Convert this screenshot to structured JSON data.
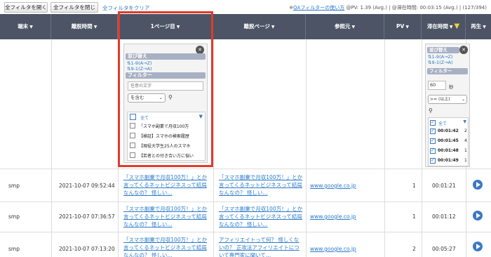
{
  "toolbar": {
    "open_all": "全フィルタを開く",
    "close_all": "全フィルタを閉じる",
    "clear_all": "全フィルタをクリア",
    "info_prefix": "※",
    "qa_link": "QAフィルターの使い方",
    "stats": "@PV: 1.39 (Avg.) | @滞在時間: 00:03:15 (Avg.) | (127/394)"
  },
  "columns": {
    "device": "端末",
    "leave_time": "離脱時間",
    "first_page": "1ページ目",
    "exit_page": "離脱ページ",
    "referrer": "参照元",
    "pv": "PV",
    "stay_time": "滞在時間",
    "replay": "再生"
  },
  "filter_first_page": {
    "sort_title": "並び替え",
    "sort_asc": "1-9(A→Z)",
    "sort_desc": "9-1(Z→A)",
    "filter_title": "フィルター",
    "search_placeholder": "任意の文字",
    "condition_value": "を含む",
    "select_all": "全て",
    "options": [
      "「スマホ副業で月収100万",
      "【検証】スマホの検索履歴",
      "【現役大学生25人のスマホ",
      "【若者との付き合い方に悩い"
    ]
  },
  "filter_stay_time": {
    "sort_title": "並び替え",
    "sort_asc": "1-9(A→Z)",
    "sort_desc": "9-1(Z→A)",
    "filter_title": "フィルター",
    "seconds_value": "60",
    "seconds_unit": "秒",
    "condition_value": ">= (以上)",
    "select_all": "全て",
    "options": [
      "00:01:42",
      "00:01:45",
      "00:01:48",
      "00:01:49"
    ],
    "option_counts": [
      "2",
      "4",
      "1",
      "1"
    ]
  },
  "rows": [
    {
      "device": "smp",
      "leave_time": "2021-10-07 09:52:44",
      "first_page": "「スマホ副業で月収100万！」とか言ってくるネットビジネスって結局なんなの？ 怪しい...",
      "exit_page": "「スマホ副業で月収100万！」とか言ってくるネットビジネスって結局なんなの？ 怪しい...",
      "referrer": "www.google.co.jp",
      "pv": "1",
      "stay_time": "00:01:21"
    },
    {
      "device": "smp",
      "leave_time": "2021-10-07 07:36:57",
      "first_page": "「スマホ副業で月収100万！」とか言ってくるネットビジネスって結局なんなの？ 怪しい...",
      "exit_page": "「スマホ副業で月収100万！」とか言ってくるネットビジネスって結局なんなの？ 怪しい...",
      "referrer": "www.google.co.jp",
      "pv": "1",
      "stay_time": "00:01:12"
    },
    {
      "device": "smp",
      "leave_time": "2021-10-07 07:13:20",
      "first_page": "「スマホ副業で月収100万！」とか言ってくるネットビジネスって結局なんなの？ 怪しい...",
      "exit_page": "アフィリエイトって何？ 怪しくないの？ 正攻法アフィリエイトについて専門家に聞いて...",
      "referrer": "www.google.co.jp",
      "pv": "2",
      "stay_time": "00:05:27"
    }
  ],
  "colors": {
    "header_bg": "#4c5465",
    "link": "#2a7ac7",
    "highlight": "#e23a2a"
  }
}
